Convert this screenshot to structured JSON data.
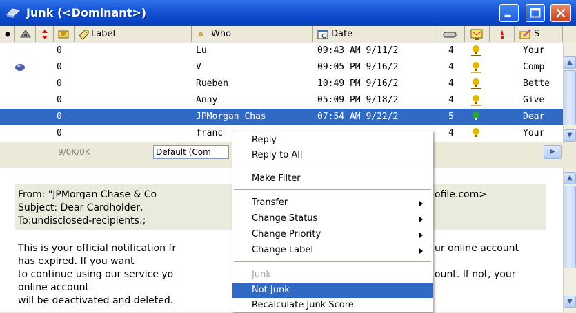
{
  "window": {
    "title": "Junk (<Dominant>)"
  },
  "columns": {
    "label": "Label",
    "who": "Who",
    "date": "Date",
    "subject_short": "S"
  },
  "messages": [
    {
      "junk": "0",
      "who": "Lu",
      "date": "09:43 AM 9/11/2",
      "priority": "4",
      "subject": "Your",
      "unread": false,
      "bulb": "#e6b800"
    },
    {
      "junk": "0",
      "who": "V",
      "date": "09:05 PM 9/16/2",
      "priority": "4",
      "subject": "Comp",
      "unread": true,
      "bulb": "#e6b800"
    },
    {
      "junk": "0",
      "who": "Rueben",
      "date": "10:49 PM 9/16/2",
      "priority": "4",
      "subject": "Bette",
      "unread": false,
      "bulb": "#e6b800"
    },
    {
      "junk": "0",
      "who": "Anny",
      "date": "05:09 PM 9/18/2",
      "priority": "4",
      "subject": "Give",
      "unread": false,
      "bulb": "#e6b800"
    },
    {
      "junk": "0",
      "who": "JPMorgan Chas",
      "date": "07:54 AM 9/22/2",
      "priority": "5",
      "subject": "Dear",
      "unread": false,
      "bulb": "#2fa32f",
      "selected": true
    },
    {
      "junk": "0",
      "who": "franc",
      "date": "",
      "priority": "4",
      "subject": "Your",
      "unread": false,
      "bulb": "#e6b800"
    }
  ],
  "status": {
    "count": "9/0K/0K",
    "filter": "Default (Com"
  },
  "preview": {
    "from": "From: \"JPMorgan Chase & Co",
    "from_tail": "ofile.com>",
    "subject": "Subject: Dear Cardholder,",
    "to": "To:undisclosed-recipients:;",
    "body1a": "This is your official notification fr",
    "body1b": "ur online account",
    "body2": "has expired. If you want",
    "body3a": "to continue using our service yo",
    "body3b": "ount. If not, your",
    "body4": "online account",
    "body5": "will be deactivated and deleted."
  },
  "menu": {
    "reply": "Reply",
    "reply_all": "Reply to All",
    "make_filter": "Make Filter",
    "transfer": "Transfer",
    "change_status": "Change Status",
    "change_priority": "Change Priority",
    "change_label": "Change Label",
    "junk": "Junk",
    "not_junk": "Not Junk",
    "recalc": "Recalculate Junk Score"
  },
  "colors": {
    "title_bar": "#0a46c8",
    "selection": "#316ac5",
    "header_bg": "#ece9d8"
  }
}
